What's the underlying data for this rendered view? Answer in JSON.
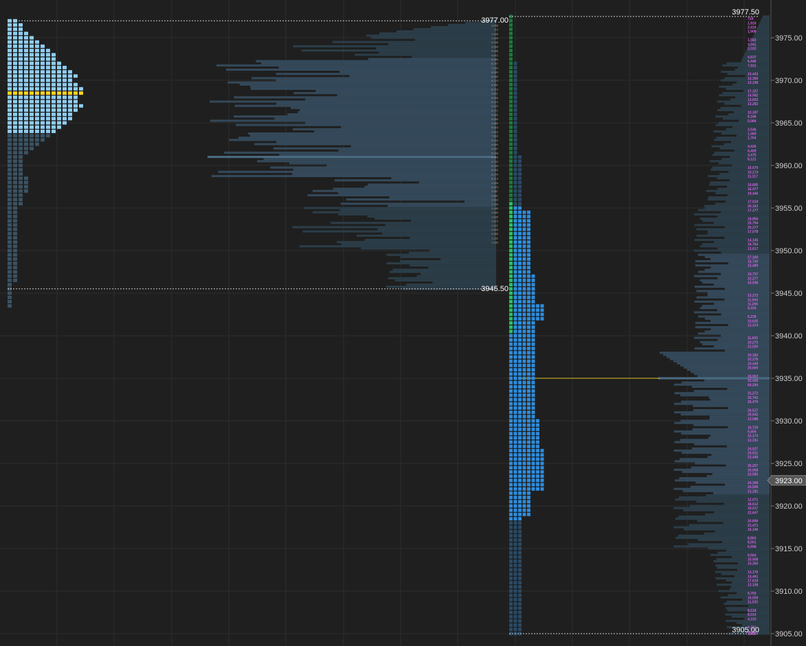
{
  "chart_data": {
    "type": "market-profile",
    "y_axis": {
      "ticks": [
        "3975.00",
        "3970.00",
        "3965.00",
        "3960.00",
        "3955.00",
        "3950.00",
        "3945.00",
        "3940.00",
        "3935.00",
        "3930.00",
        "3925.00",
        "3920.00",
        "3915.00",
        "3910.00",
        "3905.00"
      ],
      "tick_values": [
        3975,
        3970,
        3965,
        3960,
        3955,
        3950,
        3945,
        3940,
        3935,
        3930,
        3925,
        3920,
        3915,
        3910,
        3905
      ],
      "min": 3904.5,
      "max": 3978.5,
      "tick_size": 0.25,
      "side": "right",
      "grid": true
    },
    "current_price": {
      "label": "3923.00",
      "value": 3923.0
    },
    "prior_session": {
      "high": 3977.0,
      "low": 3945.5,
      "high_label": "3977.00",
      "low_label": "3945.50",
      "poc": 3968.5,
      "value_area": [
        3963.75,
        3977.0
      ],
      "tpo_counts": [
        2,
        3,
        3,
        4,
        5,
        6,
        7,
        8,
        9,
        9,
        10,
        11,
        12,
        13,
        12,
        13,
        14,
        14,
        13,
        13,
        14,
        13,
        12,
        12,
        11,
        10,
        9,
        8,
        7,
        6,
        5,
        4,
        3,
        3,
        3,
        3,
        3,
        4,
        4,
        4,
        4,
        3,
        3,
        3,
        2,
        2,
        2,
        2,
        2,
        2,
        2,
        2,
        2,
        2,
        2,
        2,
        2,
        2,
        2,
        2,
        2,
        2,
        1,
        1,
        1,
        1,
        1,
        1
      ]
    },
    "current_session": {
      "high": 3977.5,
      "low": 3905.0,
      "high_label": "3977.50",
      "low_label": "3905.00",
      "poc": 3942.75,
      "volume_poc": 3935.0,
      "initial_balance": [
        3940.5,
        3977.5
      ]
    },
    "prior_volume_labels": [
      "1,698",
      "714",
      "1,348",
      "1,828",
      "2,408",
      "3,568",
      "5,688",
      "4,612",
      "5,586",
      "6,247",
      "7,034",
      "8,884",
      "6,606",
      "6,270",
      "5,811",
      "8,216",
      "3,811",
      "5,595",
      "5,474",
      "4,220",
      "5,771",
      "4,832",
      "6,666",
      "3,562",
      "5,616",
      "2,816",
      "7,560",
      "5,216",
      "4,650",
      "4,407",
      "5,248",
      "5,094",
      "5,722",
      "5,549",
      "5,062",
      "6,276",
      "8,214",
      "4,306",
      "5,623",
      "3,087",
      "3,681",
      "2,654",
      "2,785",
      "2,485",
      "1,850",
      "1,539",
      "1,615",
      "1,321",
      "1,809",
      "2,565",
      "1,111",
      "1,336"
    ],
    "current_volume_labels": [
      {
        "p": 3977.25,
        "t": "714"
      },
      {
        "p": 3976.75,
        "t": "1,916"
      },
      {
        "p": 3976.25,
        "t": "2,416"
      },
      {
        "p": 3975.75,
        "t": "1,908"
      },
      {
        "p": 3974.75,
        "t": "1,583"
      },
      {
        "p": 3974.25,
        "t": "3,041"
      },
      {
        "p": 3973.75,
        "t": "2,032"
      },
      {
        "p": 3972.75,
        "t": "4,637"
      },
      {
        "p": 3972.25,
        "t": "6,446"
      },
      {
        "p": 3971.75,
        "t": "7,931"
      },
      {
        "p": 3970.75,
        "t": "10,443"
      },
      {
        "p": 3970.25,
        "t": "13,366"
      },
      {
        "p": 3969.75,
        "t": "13,198"
      },
      {
        "p": 3968.75,
        "t": "17,157"
      },
      {
        "p": 3968.25,
        "t": "14,582"
      },
      {
        "p": 3967.75,
        "t": "13,693"
      },
      {
        "p": 3967.25,
        "t": "12,282"
      },
      {
        "p": 3966.25,
        "t": "10,307"
      },
      {
        "p": 3965.75,
        "t": "8,186"
      },
      {
        "p": 3965.25,
        "t": "5,084"
      },
      {
        "p": 3964.25,
        "t": "2,546"
      },
      {
        "p": 3963.75,
        "t": "1,469"
      },
      {
        "p": 3963.25,
        "t": "1,764"
      },
      {
        "p": 3962.25,
        "t": "4,426"
      },
      {
        "p": 3961.75,
        "t": "6,409"
      },
      {
        "p": 3961.25,
        "t": "3,475"
      },
      {
        "p": 3960.75,
        "t": "6,121"
      },
      {
        "p": 3959.75,
        "t": "10,670"
      },
      {
        "p": 3959.25,
        "t": "10,174"
      },
      {
        "p": 3958.75,
        "t": "11,117"
      },
      {
        "p": 3957.75,
        "t": "19,605"
      },
      {
        "p": 3957.25,
        "t": "16,477"
      },
      {
        "p": 3956.75,
        "t": "19,446"
      },
      {
        "p": 3955.75,
        "t": "17,019"
      },
      {
        "p": 3955.25,
        "t": "20,163"
      },
      {
        "p": 3954.75,
        "t": "17,177"
      },
      {
        "p": 3953.75,
        "t": "18,856"
      },
      {
        "p": 3953.25,
        "t": "20,794"
      },
      {
        "p": 3952.75,
        "t": "20,277"
      },
      {
        "p": 3952.25,
        "t": "17,078"
      },
      {
        "p": 3951.25,
        "t": "14,145"
      },
      {
        "p": 3950.75,
        "t": "16,764"
      },
      {
        "p": 3950.25,
        "t": "13,617"
      },
      {
        "p": 3949.25,
        "t": "17,340"
      },
      {
        "p": 3948.75,
        "t": "16,730"
      },
      {
        "p": 3948.25,
        "t": "15,489"
      },
      {
        "p": 3947.25,
        "t": "19,737"
      },
      {
        "p": 3946.75,
        "t": "22,277"
      },
      {
        "p": 3946.25,
        "t": "24,938"
      },
      {
        "p": 3944.75,
        "t": "12,272"
      },
      {
        "p": 3944.25,
        "t": "11,004"
      },
      {
        "p": 3943.75,
        "t": "11,266"
      },
      {
        "p": 3943.25,
        "t": "8,434"
      },
      {
        "p": 3942.25,
        "t": "6,238"
      },
      {
        "p": 3941.75,
        "t": "10,635"
      },
      {
        "p": 3941.25,
        "t": "12,474"
      },
      {
        "p": 3939.75,
        "t": "11,602"
      },
      {
        "p": 3939.25,
        "t": "20,270"
      },
      {
        "p": 3938.75,
        "t": "21,020"
      },
      {
        "p": 3937.75,
        "t": "20,182"
      },
      {
        "p": 3937.25,
        "t": "22,278"
      },
      {
        "p": 3936.75,
        "t": "23,449"
      },
      {
        "p": 3936.25,
        "t": "20,600"
      },
      {
        "p": 3935.25,
        "t": "28,952"
      },
      {
        "p": 3934.75,
        "t": "32,426"
      },
      {
        "p": 3934.25,
        "t": "84,294"
      },
      {
        "p": 3933.25,
        "t": "31,272"
      },
      {
        "p": 3932.75,
        "t": "25,742"
      },
      {
        "p": 3932.25,
        "t": "26,479"
      },
      {
        "p": 3931.25,
        "t": "26,517"
      },
      {
        "p": 3930.75,
        "t": "20,642"
      },
      {
        "p": 3930.25,
        "t": "13,588"
      },
      {
        "p": 3929.25,
        "t": "16,729"
      },
      {
        "p": 3928.75,
        "t": "9,404"
      },
      {
        "p": 3928.25,
        "t": "15,174"
      },
      {
        "p": 3927.75,
        "t": "12,331"
      },
      {
        "p": 3926.75,
        "t": "24,027"
      },
      {
        "p": 3926.25,
        "t": "24,011"
      },
      {
        "p": 3925.75,
        "t": "23,448"
      },
      {
        "p": 3924.75,
        "t": "26,257"
      },
      {
        "p": 3924.25,
        "t": "20,058"
      },
      {
        "p": 3923.75,
        "t": "22,582"
      },
      {
        "p": 3922.75,
        "t": "24,308"
      },
      {
        "p": 3922.25,
        "t": "24,506"
      },
      {
        "p": 3921.75,
        "t": "21,181"
      },
      {
        "p": 3920.75,
        "t": "12,071"
      },
      {
        "p": 3920.25,
        "t": "18,612"
      },
      {
        "p": 3919.75,
        "t": "19,017"
      },
      {
        "p": 3919.25,
        "t": "22,647"
      },
      {
        "p": 3918.25,
        "t": "20,656"
      },
      {
        "p": 3917.75,
        "t": "21,471"
      },
      {
        "p": 3917.25,
        "t": "16,146"
      },
      {
        "p": 3916.25,
        "t": "8,862"
      },
      {
        "p": 3915.75,
        "t": "8,001"
      },
      {
        "p": 3915.25,
        "t": "6,558"
      },
      {
        "p": 3914.25,
        "t": "9,564"
      },
      {
        "p": 3913.75,
        "t": "10,508"
      },
      {
        "p": 3913.25,
        "t": "10,350"
      },
      {
        "p": 3912.25,
        "t": "13,176"
      },
      {
        "p": 3911.75,
        "t": "14,461"
      },
      {
        "p": 3911.25,
        "t": "17,619"
      },
      {
        "p": 3910.75,
        "t": "12,108"
      },
      {
        "p": 3909.75,
        "t": "9,750"
      },
      {
        "p": 3909.25,
        "t": "10,559"
      },
      {
        "p": 3908.75,
        "t": "11,025"
      },
      {
        "p": 3907.75,
        "t": "8,518"
      },
      {
        "p": 3907.25,
        "t": "8,014"
      },
      {
        "p": 3906.75,
        "t": "4,153"
      },
      {
        "p": 3905.75,
        "t": "4,721"
      },
      {
        "p": 3905.25,
        "t": "3,733"
      },
      {
        "p": 3905.0,
        "t": "1,086"
      }
    ],
    "colors": {
      "background": "#1f1f1f",
      "grid": "#2c2c2c",
      "prior_tpo": "#8fcdf0",
      "prior_tpo_dim": "#3a5364",
      "current_tpo": "#2e8cdc",
      "current_tpo_dim": "#2a4a66",
      "initial_balance": "#1b7a3a",
      "initial_balance_bright": "#22c55e",
      "poc": "#ffd21f",
      "volume_bar": "#2b3d48",
      "volume_bar_va": "#34495a",
      "volume_bar_hvn": "#4a6b82",
      "volume_text": "#d060e0",
      "volume_poc_line": "#e0c020",
      "range_line": "#cccccc",
      "axis_text": "#cfcfcf",
      "price_tag": "#555555"
    }
  }
}
